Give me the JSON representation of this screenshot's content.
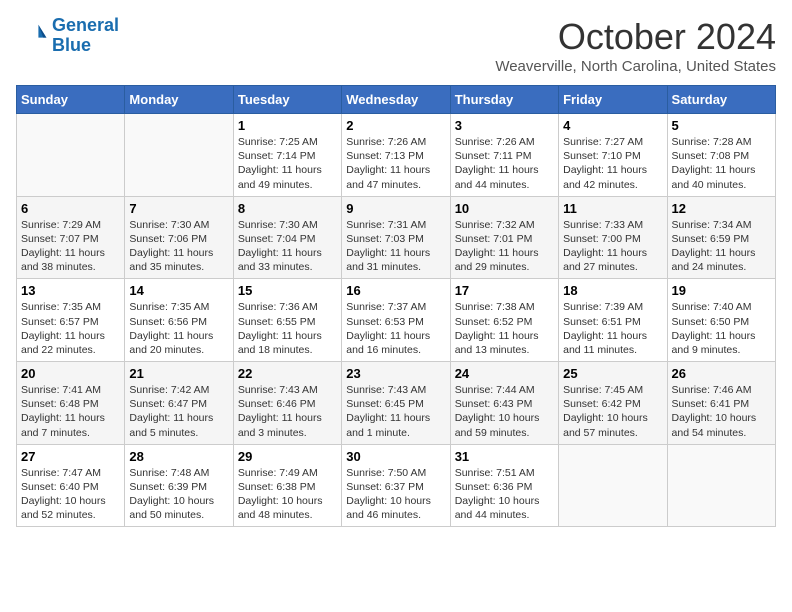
{
  "logo": {
    "line1": "General",
    "line2": "Blue"
  },
  "title": "October 2024",
  "subtitle": "Weaverville, North Carolina, United States",
  "days_of_week": [
    "Sunday",
    "Monday",
    "Tuesday",
    "Wednesday",
    "Thursday",
    "Friday",
    "Saturday"
  ],
  "weeks": [
    [
      {
        "day": "",
        "info": ""
      },
      {
        "day": "",
        "info": ""
      },
      {
        "day": "1",
        "info": "Sunrise: 7:25 AM\nSunset: 7:14 PM\nDaylight: 11 hours and 49 minutes."
      },
      {
        "day": "2",
        "info": "Sunrise: 7:26 AM\nSunset: 7:13 PM\nDaylight: 11 hours and 47 minutes."
      },
      {
        "day": "3",
        "info": "Sunrise: 7:26 AM\nSunset: 7:11 PM\nDaylight: 11 hours and 44 minutes."
      },
      {
        "day": "4",
        "info": "Sunrise: 7:27 AM\nSunset: 7:10 PM\nDaylight: 11 hours and 42 minutes."
      },
      {
        "day": "5",
        "info": "Sunrise: 7:28 AM\nSunset: 7:08 PM\nDaylight: 11 hours and 40 minutes."
      }
    ],
    [
      {
        "day": "6",
        "info": "Sunrise: 7:29 AM\nSunset: 7:07 PM\nDaylight: 11 hours and 38 minutes."
      },
      {
        "day": "7",
        "info": "Sunrise: 7:30 AM\nSunset: 7:06 PM\nDaylight: 11 hours and 35 minutes."
      },
      {
        "day": "8",
        "info": "Sunrise: 7:30 AM\nSunset: 7:04 PM\nDaylight: 11 hours and 33 minutes."
      },
      {
        "day": "9",
        "info": "Sunrise: 7:31 AM\nSunset: 7:03 PM\nDaylight: 11 hours and 31 minutes."
      },
      {
        "day": "10",
        "info": "Sunrise: 7:32 AM\nSunset: 7:01 PM\nDaylight: 11 hours and 29 minutes."
      },
      {
        "day": "11",
        "info": "Sunrise: 7:33 AM\nSunset: 7:00 PM\nDaylight: 11 hours and 27 minutes."
      },
      {
        "day": "12",
        "info": "Sunrise: 7:34 AM\nSunset: 6:59 PM\nDaylight: 11 hours and 24 minutes."
      }
    ],
    [
      {
        "day": "13",
        "info": "Sunrise: 7:35 AM\nSunset: 6:57 PM\nDaylight: 11 hours and 22 minutes."
      },
      {
        "day": "14",
        "info": "Sunrise: 7:35 AM\nSunset: 6:56 PM\nDaylight: 11 hours and 20 minutes."
      },
      {
        "day": "15",
        "info": "Sunrise: 7:36 AM\nSunset: 6:55 PM\nDaylight: 11 hours and 18 minutes."
      },
      {
        "day": "16",
        "info": "Sunrise: 7:37 AM\nSunset: 6:53 PM\nDaylight: 11 hours and 16 minutes."
      },
      {
        "day": "17",
        "info": "Sunrise: 7:38 AM\nSunset: 6:52 PM\nDaylight: 11 hours and 13 minutes."
      },
      {
        "day": "18",
        "info": "Sunrise: 7:39 AM\nSunset: 6:51 PM\nDaylight: 11 hours and 11 minutes."
      },
      {
        "day": "19",
        "info": "Sunrise: 7:40 AM\nSunset: 6:50 PM\nDaylight: 11 hours and 9 minutes."
      }
    ],
    [
      {
        "day": "20",
        "info": "Sunrise: 7:41 AM\nSunset: 6:48 PM\nDaylight: 11 hours and 7 minutes."
      },
      {
        "day": "21",
        "info": "Sunrise: 7:42 AM\nSunset: 6:47 PM\nDaylight: 11 hours and 5 minutes."
      },
      {
        "day": "22",
        "info": "Sunrise: 7:43 AM\nSunset: 6:46 PM\nDaylight: 11 hours and 3 minutes."
      },
      {
        "day": "23",
        "info": "Sunrise: 7:43 AM\nSunset: 6:45 PM\nDaylight: 11 hours and 1 minute."
      },
      {
        "day": "24",
        "info": "Sunrise: 7:44 AM\nSunset: 6:43 PM\nDaylight: 10 hours and 59 minutes."
      },
      {
        "day": "25",
        "info": "Sunrise: 7:45 AM\nSunset: 6:42 PM\nDaylight: 10 hours and 57 minutes."
      },
      {
        "day": "26",
        "info": "Sunrise: 7:46 AM\nSunset: 6:41 PM\nDaylight: 10 hours and 54 minutes."
      }
    ],
    [
      {
        "day": "27",
        "info": "Sunrise: 7:47 AM\nSunset: 6:40 PM\nDaylight: 10 hours and 52 minutes."
      },
      {
        "day": "28",
        "info": "Sunrise: 7:48 AM\nSunset: 6:39 PM\nDaylight: 10 hours and 50 minutes."
      },
      {
        "day": "29",
        "info": "Sunrise: 7:49 AM\nSunset: 6:38 PM\nDaylight: 10 hours and 48 minutes."
      },
      {
        "day": "30",
        "info": "Sunrise: 7:50 AM\nSunset: 6:37 PM\nDaylight: 10 hours and 46 minutes."
      },
      {
        "day": "31",
        "info": "Sunrise: 7:51 AM\nSunset: 6:36 PM\nDaylight: 10 hours and 44 minutes."
      },
      {
        "day": "",
        "info": ""
      },
      {
        "day": "",
        "info": ""
      }
    ]
  ],
  "colors": {
    "header_bg": "#3a6dbf",
    "header_text": "#ffffff",
    "even_row_bg": "#f5f5f5",
    "odd_row_bg": "#ffffff"
  }
}
